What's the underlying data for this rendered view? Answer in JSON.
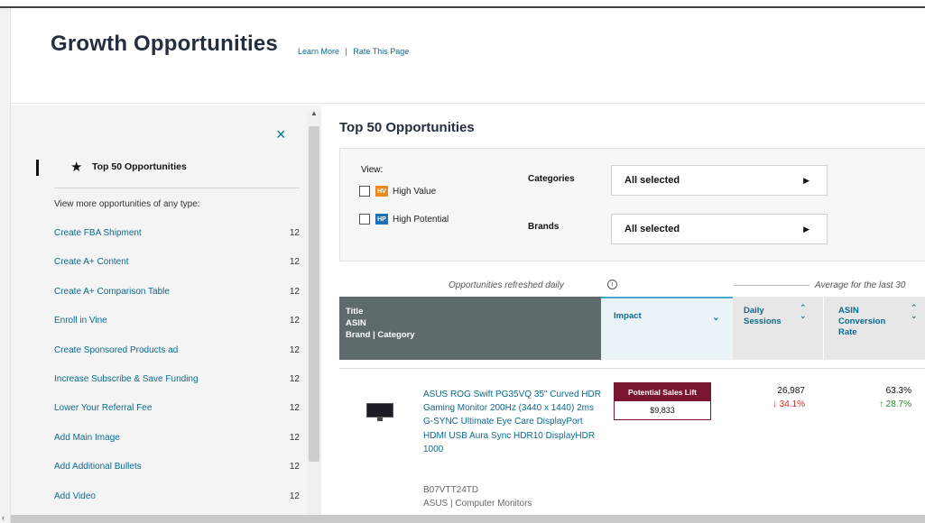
{
  "header": {
    "title": "Growth Opportunities",
    "learn_more": "Learn More",
    "separator": "|",
    "rate_page": "Rate This Page"
  },
  "sidebar": {
    "close_icon": "×",
    "selected_label": "Top 50 Opportunities",
    "subheading": "View more opportunities of any type:",
    "items": [
      {
        "label": "Create FBA Shipment",
        "count": "12"
      },
      {
        "label": "Create A+ Content",
        "count": "12"
      },
      {
        "label": "Create A+ Comparison Table",
        "count": "12"
      },
      {
        "label": "Enroll in Vine",
        "count": "12"
      },
      {
        "label": "Create Sponsored Products ad",
        "count": "12"
      },
      {
        "label": "Increase Subscribe & Save Funding",
        "count": "12"
      },
      {
        "label": "Lower Your Referral Fee",
        "count": "12"
      },
      {
        "label": "Add Main Image",
        "count": "12"
      },
      {
        "label": "Add Additional Bullets",
        "count": "12"
      },
      {
        "label": "Add Video",
        "count": "12"
      }
    ]
  },
  "main": {
    "title": "Top 50 Opportunities",
    "filters": {
      "view_label": "View:",
      "high_value_tag": "HV",
      "high_value_label": "High Value",
      "high_potential_tag": "HP",
      "high_potential_label": "High Potential",
      "categories_label": "Categories",
      "categories_value": "All selected",
      "brands_label": "Brands",
      "brands_value": "All selected"
    },
    "refresh_note": "Opportunities refreshed daily",
    "avg_note": "Average for the last 30",
    "columns": {
      "title_l1": "Title",
      "title_l2": "ASIN",
      "title_l3": "Brand | Category",
      "impact": "Impact",
      "sessions_l1": "Daily",
      "sessions_l2": "Sessions",
      "conv_l1": "ASIN",
      "conv_l2": "Conversion",
      "conv_l3": "Rate"
    },
    "row": {
      "title": "ASUS ROG Swift PG35VQ 35\" Curved HDR Gaming Monitor 200Hz (3440 x 1440) 2ms G-SYNC Ultimate Eye Care DisplayPort HDMI USB Aura Sync HDR10 DisplayHDR 1000",
      "asin": "B07VTT24TD",
      "brand_category": "ASUS | Computer Monitors",
      "lift_label": "Potential Sales Lift",
      "lift_value": "$9,833",
      "sessions": "26,987",
      "sessions_change": "↓ 34.1%",
      "conversion": "63.3%",
      "conversion_change": "↑ 28.7%"
    }
  },
  "colors": {
    "brand_dark": "#232f3e",
    "link": "#0a6b8e",
    "lift": "#7a1530",
    "down": "#d12b20",
    "up": "#2d8a2d",
    "hv_tag": "#e88a1a",
    "hp_tag": "#1f6fb5"
  }
}
